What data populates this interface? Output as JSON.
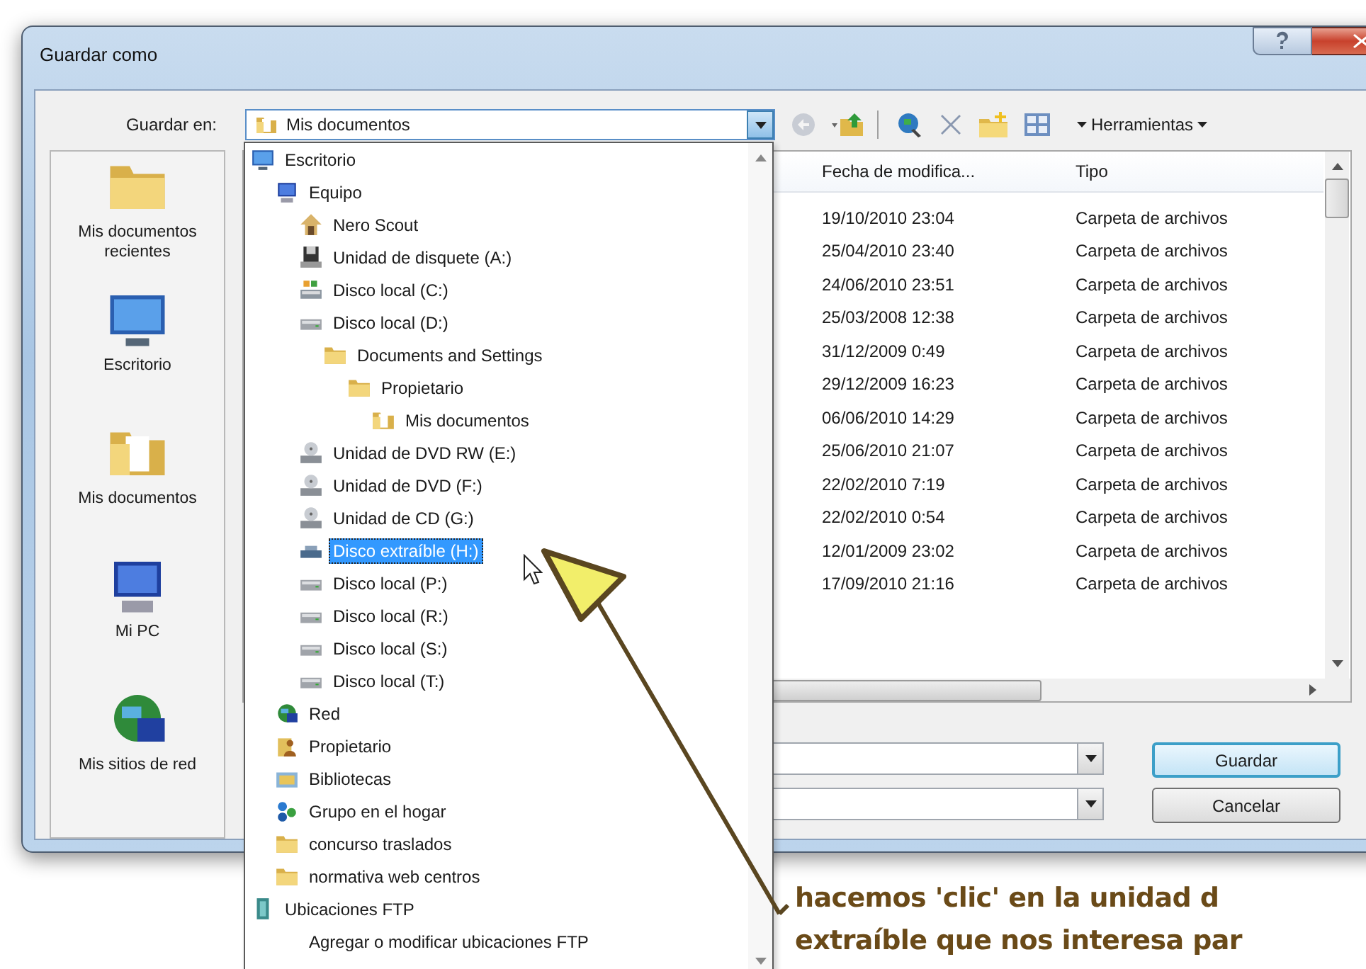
{
  "window": {
    "title": "Guardar como"
  },
  "save_in": {
    "label": "Guardar en:",
    "value": "Mis documentos"
  },
  "toolbar": {
    "tools_label": "Herramientas"
  },
  "places": [
    {
      "label": "Mis documentos recientes",
      "kind": "recent"
    },
    {
      "label": "Escritorio",
      "kind": "desktop"
    },
    {
      "label": "Mis documentos",
      "kind": "documents"
    },
    {
      "label": "Mi PC",
      "kind": "computer"
    },
    {
      "label": "Mis sitios de red",
      "kind": "network"
    }
  ],
  "file_list": {
    "columns": [
      "Fecha de modifica...",
      "Tipo"
    ],
    "rows": [
      {
        "date": "19/10/2010 23:04",
        "type": "Carpeta de archivos"
      },
      {
        "date": "25/04/2010 23:40",
        "type": "Carpeta de archivos"
      },
      {
        "date": "24/06/2010 23:51",
        "type": "Carpeta de archivos"
      },
      {
        "date": "25/03/2008 12:38",
        "type": "Carpeta de archivos"
      },
      {
        "date": "31/12/2009 0:49",
        "type": "Carpeta de archivos"
      },
      {
        "date": "29/12/2009 16:23",
        "type": "Carpeta de archivos"
      },
      {
        "date": "06/06/2010 14:29",
        "type": "Carpeta de archivos"
      },
      {
        "date": "25/06/2010 21:07",
        "type": "Carpeta de archivos"
      },
      {
        "date": "22/02/2010 7:19",
        "type": "Carpeta de archivos"
      },
      {
        "date": "22/02/2010 0:54",
        "type": "Carpeta de archivos"
      },
      {
        "date": "12/01/2009 23:02",
        "type": "Carpeta de archivos"
      },
      {
        "date": "17/09/2010 21:16",
        "type": "Carpeta de archivos"
      }
    ]
  },
  "buttons": [
    {
      "label": "Guardar",
      "default": true
    },
    {
      "label": "Cancelar",
      "default": false
    }
  ],
  "location_dropdown": {
    "items": [
      {
        "label": "Escritorio",
        "kind": "desktop",
        "selected": false,
        "children": [
          {
            "label": "Equipo",
            "kind": "computer",
            "selected": false,
            "children": [
              {
                "label": "Nero Scout",
                "kind": "app",
                "selected": false
              },
              {
                "label": "Unidad de disquete (A:)",
                "kind": "floppy",
                "selected": false
              },
              {
                "label": "Disco local (C:)",
                "kind": "system_drive",
                "selected": false
              },
              {
                "label": "Disco local (D:)",
                "kind": "drive",
                "selected": false,
                "children": [
                  {
                    "label": "Documents and Settings",
                    "kind": "folder",
                    "selected": false,
                    "children": [
                      {
                        "label": "Propietario",
                        "kind": "folder",
                        "selected": false,
                        "children": [
                          {
                            "label": "Mis documentos",
                            "kind": "documents",
                            "selected": false
                          }
                        ]
                      }
                    ]
                  }
                ]
              },
              {
                "label": "Unidad de DVD RW (E:)",
                "kind": "disc",
                "selected": false
              },
              {
                "label": "Unidad de DVD (F:)",
                "kind": "disc",
                "selected": false
              },
              {
                "label": "Unidad de CD (G:)",
                "kind": "disc",
                "selected": false
              },
              {
                "label": "Disco extraíble (H:)",
                "kind": "removable",
                "selected": true
              },
              {
                "label": "Disco local (P:)",
                "kind": "drive",
                "selected": false
              },
              {
                "label": "Disco local (R:)",
                "kind": "drive",
                "selected": false
              },
              {
                "label": "Disco local (S:)",
                "kind": "drive",
                "selected": false
              },
              {
                "label": "Disco local (T:)",
                "kind": "drive",
                "selected": false
              }
            ]
          },
          {
            "label": "Red",
            "kind": "network",
            "selected": false
          },
          {
            "label": "Propietario",
            "kind": "user",
            "selected": false
          },
          {
            "label": "Bibliotecas",
            "kind": "library",
            "selected": false
          },
          {
            "label": "Grupo en el hogar",
            "kind": "homegroup",
            "selected": false
          },
          {
            "label": "concurso traslados",
            "kind": "folder",
            "selected": false
          },
          {
            "label": "normativa web centros",
            "kind": "folder",
            "selected": false
          }
        ]
      },
      {
        "label": "Ubicaciones FTP",
        "kind": "ftp",
        "selected": false,
        "children": [
          {
            "label": "Agregar o modificar ubicaciones FTP",
            "kind": "none",
            "selected": false
          }
        ]
      }
    ]
  },
  "annotation": {
    "lines": [
      "hacemos 'clic' en la unidad d",
      "extraíble que nos interesa par"
    ]
  }
}
